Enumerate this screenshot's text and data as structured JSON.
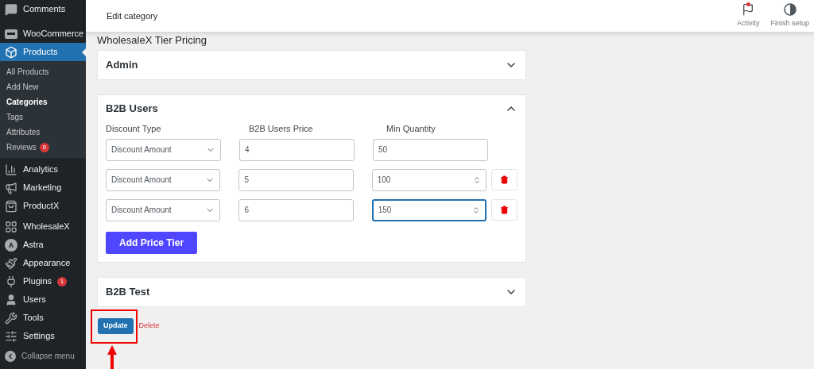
{
  "sidebar": {
    "items": [
      {
        "label": "Comments",
        "selected": false
      },
      {
        "label": "WooCommerce",
        "selected": false
      },
      {
        "label": "Products",
        "selected": true,
        "children": [
          {
            "label": "All Products",
            "selected": false
          },
          {
            "label": "Add New",
            "selected": false
          },
          {
            "label": "Categories",
            "selected": true
          },
          {
            "label": "Tags",
            "selected": false
          },
          {
            "label": "Attributes",
            "selected": false
          },
          {
            "label": "Reviews",
            "selected": false,
            "badge": "9"
          }
        ]
      },
      {
        "label": "Analytics",
        "selected": false
      },
      {
        "label": "Marketing",
        "selected": false
      },
      {
        "label": "ProductX",
        "selected": false
      },
      {
        "label": "WholesaleX",
        "selected": false
      },
      {
        "label": "Astra",
        "selected": false
      },
      {
        "label": "Appearance",
        "selected": false
      },
      {
        "label": "Plugins",
        "selected": false,
        "badge": "1"
      },
      {
        "label": "Users",
        "selected": false
      },
      {
        "label": "Tools",
        "selected": false
      },
      {
        "label": "Settings",
        "selected": false
      }
    ],
    "collapse": "Collapse menu"
  },
  "header": {
    "title": "Edit category",
    "actions": [
      "Activity",
      "Finish setup"
    ]
  },
  "heading": "WholesaleX Tier Pricing",
  "sections": [
    {
      "title": "Admin",
      "expanded": false
    },
    {
      "title": "B2B Users",
      "expanded": true,
      "columns": [
        "Discount Type",
        "B2B Users Price",
        "Min Quantity"
      ],
      "tiers": [
        {
          "discount_type": "Discount Amount",
          "price": "4",
          "min_quantity": "50",
          "removable": false,
          "focused": false
        },
        {
          "discount_type": "Discount Amount",
          "price": "5",
          "min_quantity": "100",
          "removable": true,
          "focused": false
        },
        {
          "discount_type": "Discount Amount",
          "price": "6",
          "min_quantity": "150",
          "removable": true,
          "focused": true
        }
      ],
      "add_button": "Add Price Tier"
    },
    {
      "title": "B2B Test",
      "expanded": false
    }
  ],
  "update_button": "Update",
  "delete_link": "Delete"
}
